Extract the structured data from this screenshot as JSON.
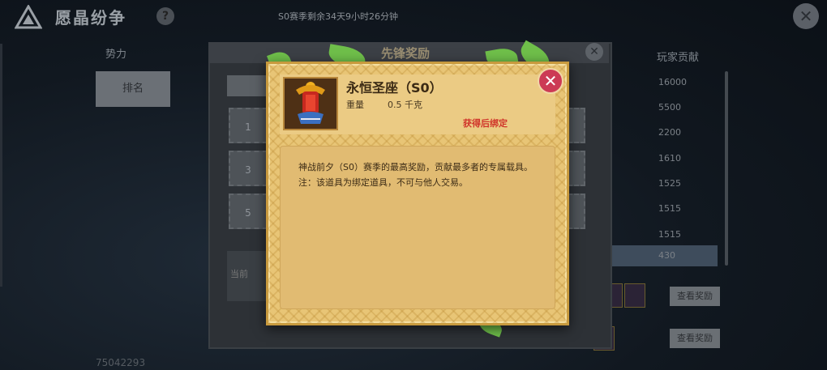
{
  "header": {
    "title": "愿晶纷争",
    "help_label": "?",
    "season_timer": "S0赛季剩余34天9小时26分钟",
    "close_label": "✕"
  },
  "sidebar": {
    "faction_label": "势力",
    "rank_label": "排名",
    "player_id": "75042293"
  },
  "ranking_table": {
    "contribution_header": "玩家贡献",
    "contributions": [
      "16000",
      "5500",
      "2200",
      "1610",
      "1525",
      "1515",
      "1515",
      "430"
    ],
    "view_reward_labels": [
      "查看奖励",
      "查看奖励"
    ]
  },
  "reward_panel": {
    "title": "先锋奖励",
    "rank_numbers": [
      "1",
      "3",
      "5"
    ],
    "bottom_label": "当前",
    "close_label": "✕"
  },
  "item_popup": {
    "name": "永恒圣座（S0）",
    "weight_label": "重量",
    "weight_value": "0.5 千克",
    "bind_note": "获得后绑定",
    "description": "神战前夕（S0）赛季的最高奖励，贡献最多者的专属载具。注：该道具为绑定道具，不可与他人交易。",
    "close_icon": "close-icon"
  },
  "colors": {
    "popup_bg": "#e8c576",
    "popup_border": "#c89a3e",
    "bind_note": "#d0342a",
    "close_button": "#cc3a55",
    "leaf": "#6fbf4a"
  }
}
